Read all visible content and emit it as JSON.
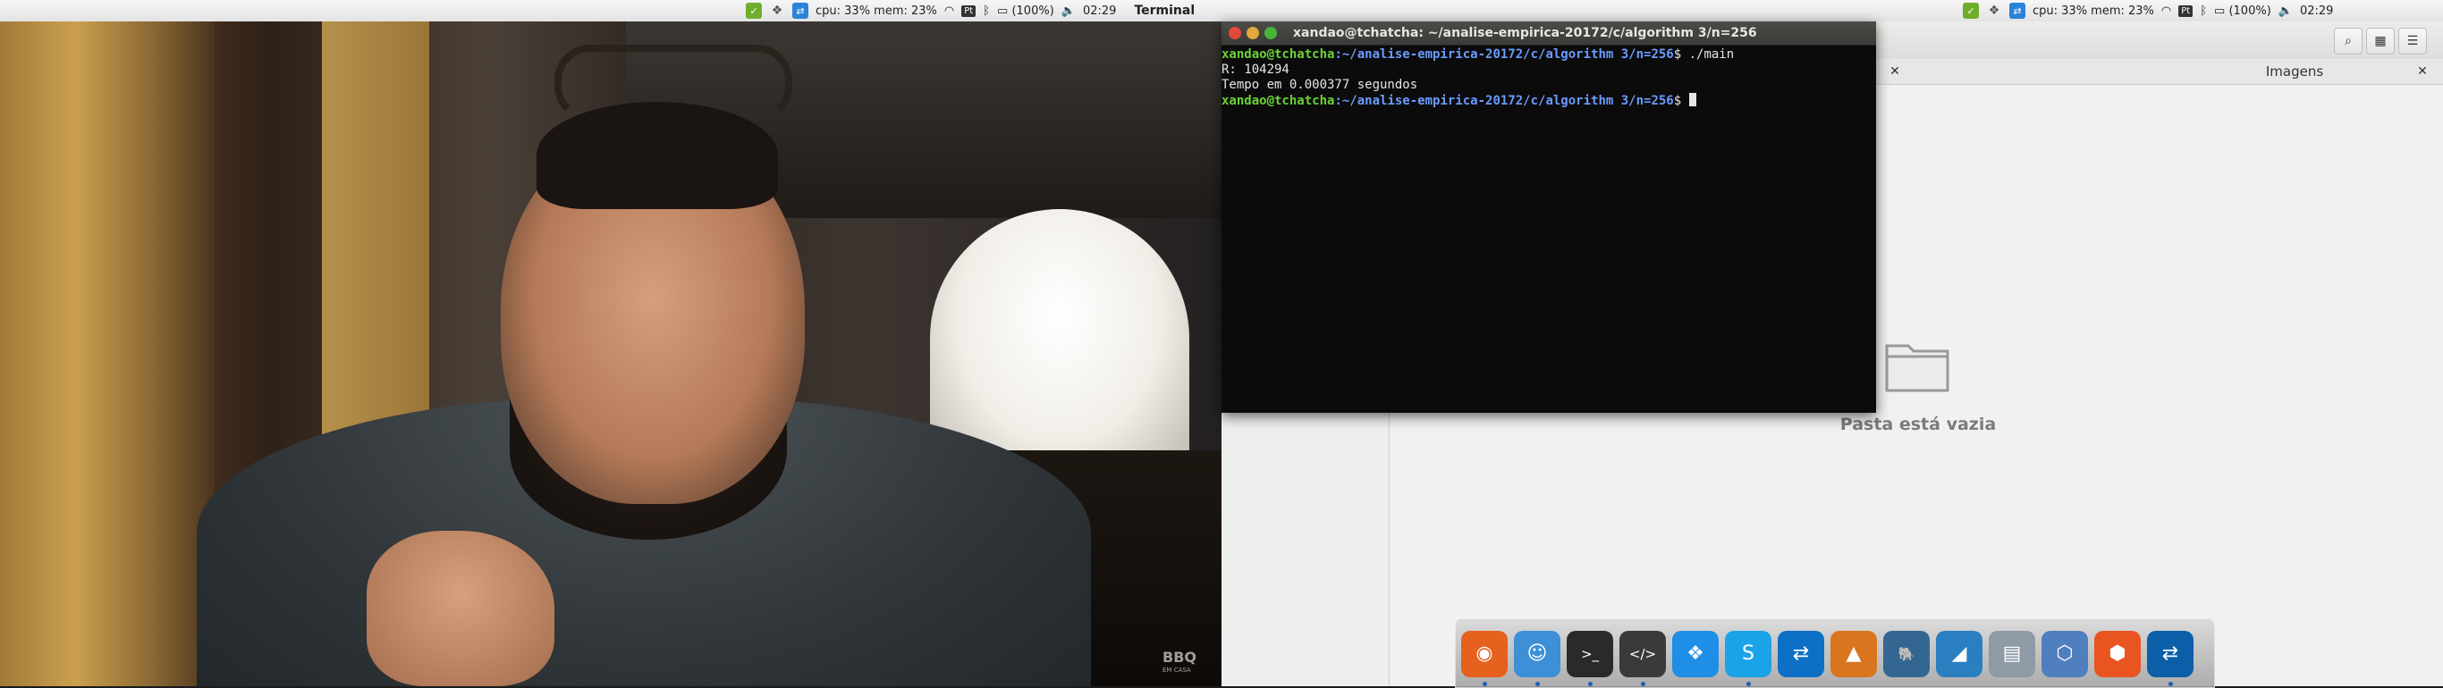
{
  "panel_left": {
    "cpu_mem": "cpu: 33% mem: 23%",
    "keyboard": "Pt",
    "battery": "(100%)",
    "time": "02:29",
    "app_name": "Terminal"
  },
  "panel_right": {
    "cpu_mem": "cpu: 33% mem: 23%",
    "keyboard": "Pt",
    "battery": "(100%)",
    "time": "02:29"
  },
  "video": {
    "watermark_top": "BBQ",
    "watermark_bottom": "EM CASA"
  },
  "file_manager": {
    "tab_title": "Imagens",
    "empty_label": "Pasta está vazia"
  },
  "terminal": {
    "title": "xandao@tchatcha: ~/analise-empirica-20172/c/algorithm 3/n=256",
    "prompt_user": "xandao@tchatcha",
    "prompt_path": ":~/analise-empirica-20172/c/algorithm 3/n=256",
    "prompt_suffix": "$ ",
    "command": "./main",
    "output_line1": "R: 104294",
    "output_line2": "Tempo em 0.000377 segundos"
  },
  "dock": {
    "items": [
      {
        "icon": "firefox-icon",
        "color": "#e6601e",
        "running": true
      },
      {
        "icon": "finder-icon",
        "color": "#3d8fd6",
        "running": true
      },
      {
        "icon": "terminal-icon",
        "color": "#2a2a2a",
        "running": true
      },
      {
        "icon": "code-editor-icon",
        "color": "#3a3a3a",
        "running": true
      },
      {
        "icon": "dropbox-icon",
        "color": "#1f8ee6",
        "running": false
      },
      {
        "icon": "skype-icon",
        "color": "#1aa3e8",
        "running": true
      },
      {
        "icon": "teamviewer-icon",
        "color": "#0e6fc6",
        "running": false
      },
      {
        "icon": "matlab-icon",
        "color": "#d8751e",
        "running": false
      },
      {
        "icon": "postgres-icon",
        "color": "#336791",
        "running": false
      },
      {
        "icon": "mysql-workbench-icon",
        "color": "#2a7fc0",
        "running": false
      },
      {
        "icon": "scanner-icon",
        "color": "#8e9aa6",
        "running": false
      },
      {
        "icon": "virtualbox-icon",
        "color": "#4f7fbf",
        "running": false
      },
      {
        "icon": "ubuntu-software-icon",
        "color": "#e95420",
        "running": false
      },
      {
        "icon": "teamviewer-alt-icon",
        "color": "#0b5fa8",
        "running": true
      }
    ]
  }
}
